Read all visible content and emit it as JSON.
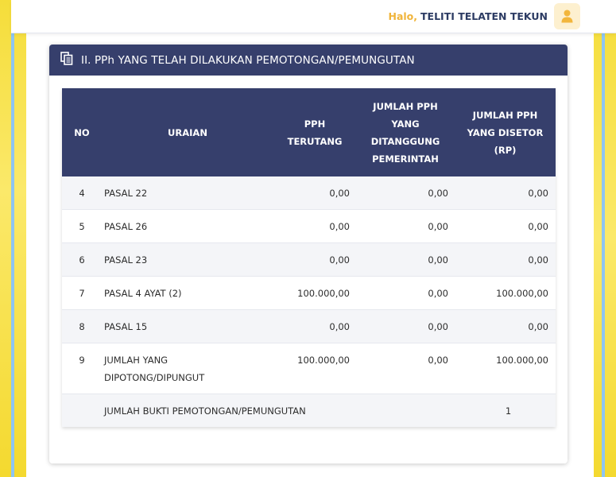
{
  "header": {
    "greeting_prefix": "Halo,",
    "user_name": "TELITI TELATEN TEKUN",
    "avatar_icon": "user-icon"
  },
  "section": {
    "title": "II. PPh YANG TELAH DILAKUKAN PEMOTONGAN/PEMUNGUTAN",
    "icon": "document-copy-icon"
  },
  "table": {
    "columns": {
      "no": "NO",
      "uraian": "URAIAN",
      "pph_terutang": "PPH TERUTANG",
      "jumlah_ditanggung": "JUMLAH PPH YANG DITANGGUNG PEMERINTAH",
      "jumlah_disetor": "JUMLAH PPH YANG DISETOR (RP)"
    },
    "rows": [
      {
        "no": "4",
        "uraian": "PASAL 22",
        "pph_terutang": "0,00",
        "ditanggung": "0,00",
        "disetor": "0,00"
      },
      {
        "no": "5",
        "uraian": "PASAL 26",
        "pph_terutang": "0,00",
        "ditanggung": "0,00",
        "disetor": "0,00"
      },
      {
        "no": "6",
        "uraian": "PASAL 23",
        "pph_terutang": "0,00",
        "ditanggung": "0,00",
        "disetor": "0,00"
      },
      {
        "no": "7",
        "uraian": "PASAL 4 AYAT (2)",
        "pph_terutang": "100.000,00",
        "ditanggung": "0,00",
        "disetor": "100.000,00"
      },
      {
        "no": "8",
        "uraian": "PASAL 15",
        "pph_terutang": "0,00",
        "ditanggung": "0,00",
        "disetor": "0,00"
      },
      {
        "no": "9",
        "uraian": "JUMLAH YANG DIPOTONG/DIPUNGUT",
        "pph_terutang": "100.000,00",
        "ditanggung": "0,00",
        "disetor": "100.000,00"
      }
    ],
    "summary": {
      "label": "JUMLAH BUKTI PEMOTONGAN/PEMUNGUTAN",
      "count": "1"
    }
  },
  "colors": {
    "header_bg": "#363f6c",
    "greeting_accent": "#f0b43a",
    "user_name_color": "#2c3b63",
    "row_alt_bg": "#f4f5f8"
  }
}
